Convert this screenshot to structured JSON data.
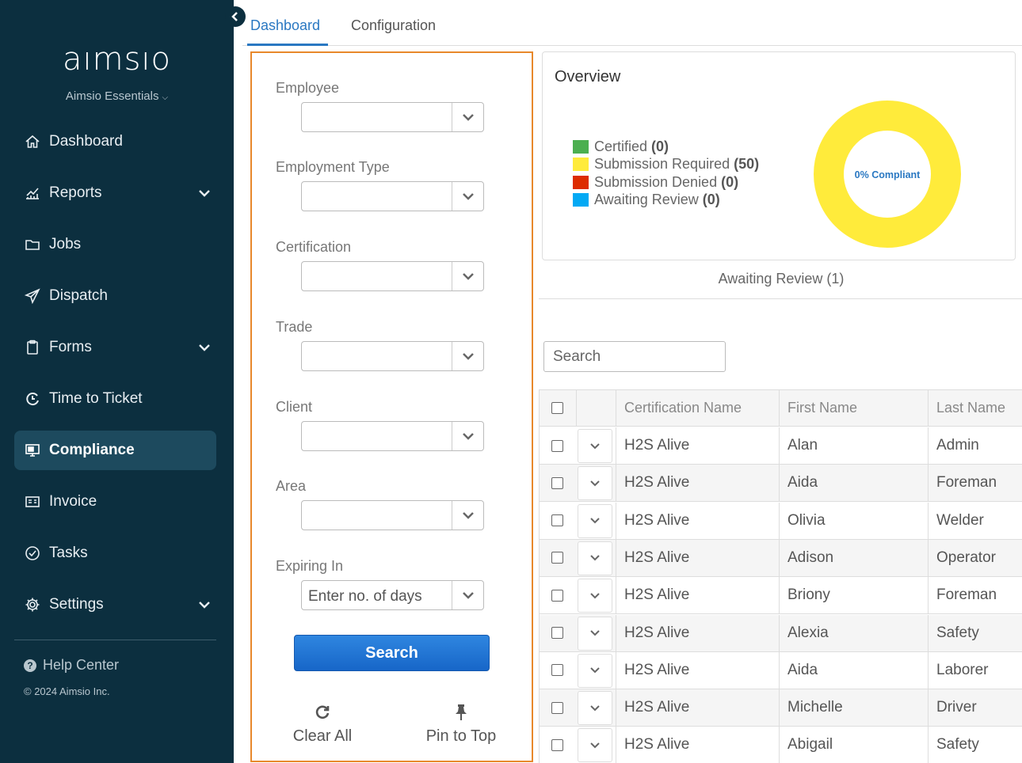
{
  "sidebar": {
    "logo": "aımsıo",
    "product": "Aimsio Essentials",
    "items": [
      {
        "label": "Dashboard",
        "icon": "home-icon"
      },
      {
        "label": "Reports",
        "icon": "chart-icon"
      },
      {
        "label": "Jobs",
        "icon": "folder-icon"
      },
      {
        "label": "Dispatch",
        "icon": "send-icon"
      },
      {
        "label": "Forms",
        "icon": "clipboard-icon"
      },
      {
        "label": "Time to Ticket",
        "icon": "time-ticket-icon"
      },
      {
        "label": "Compliance",
        "icon": "compliance-icon"
      },
      {
        "label": "Invoice",
        "icon": "invoice-icon"
      },
      {
        "label": "Tasks",
        "icon": "check-circle-icon"
      },
      {
        "label": "Settings",
        "icon": "gear-icon"
      }
    ],
    "help": "Help Center",
    "copyright": "© 2024 Aimsio Inc."
  },
  "tabs": {
    "dashboard": "Dashboard",
    "configuration": "Configuration"
  },
  "filters": {
    "employee": "Employee",
    "employment_type": "Employment Type",
    "certification": "Certification",
    "trade": "Trade",
    "client": "Client",
    "area": "Area",
    "expiring_in": "Expiring In",
    "expiring_placeholder": "Enter no. of days",
    "search_button": "Search",
    "clear_all": "Clear All",
    "pin_to_top": "Pin to Top"
  },
  "overview": {
    "title": "Overview",
    "legend": [
      {
        "label": "Certified",
        "count": "(0)",
        "color": "#4caf50"
      },
      {
        "label": "Submission Required",
        "count": "(50)",
        "color": "#ffeb3b"
      },
      {
        "label": "Submission Denied",
        "count": "(0)",
        "color": "#dd2c00"
      },
      {
        "label": "Awaiting Review",
        "count": "(0)",
        "color": "#03a9f4"
      }
    ],
    "center_label": "0% Compliant"
  },
  "awaiting_review": "Awaiting Review (1)",
  "search_placeholder": "Search",
  "table": {
    "headers": [
      "Certification Name",
      "First Name",
      "Last Name"
    ],
    "rows": [
      [
        "H2S Alive",
        "Alan",
        "Admin"
      ],
      [
        "H2S Alive",
        "Aida",
        "Foreman"
      ],
      [
        "H2S Alive",
        "Olivia",
        "Welder"
      ],
      [
        "H2S Alive",
        "Adison",
        "Operator"
      ],
      [
        "H2S Alive",
        "Briony",
        "Foreman"
      ],
      [
        "H2S Alive",
        "Alexia",
        "Safety"
      ],
      [
        "H2S Alive",
        "Aida",
        "Laborer"
      ],
      [
        "H2S Alive",
        "Michelle",
        "Driver"
      ],
      [
        "H2S Alive",
        "Abigail",
        "Safety"
      ]
    ]
  }
}
